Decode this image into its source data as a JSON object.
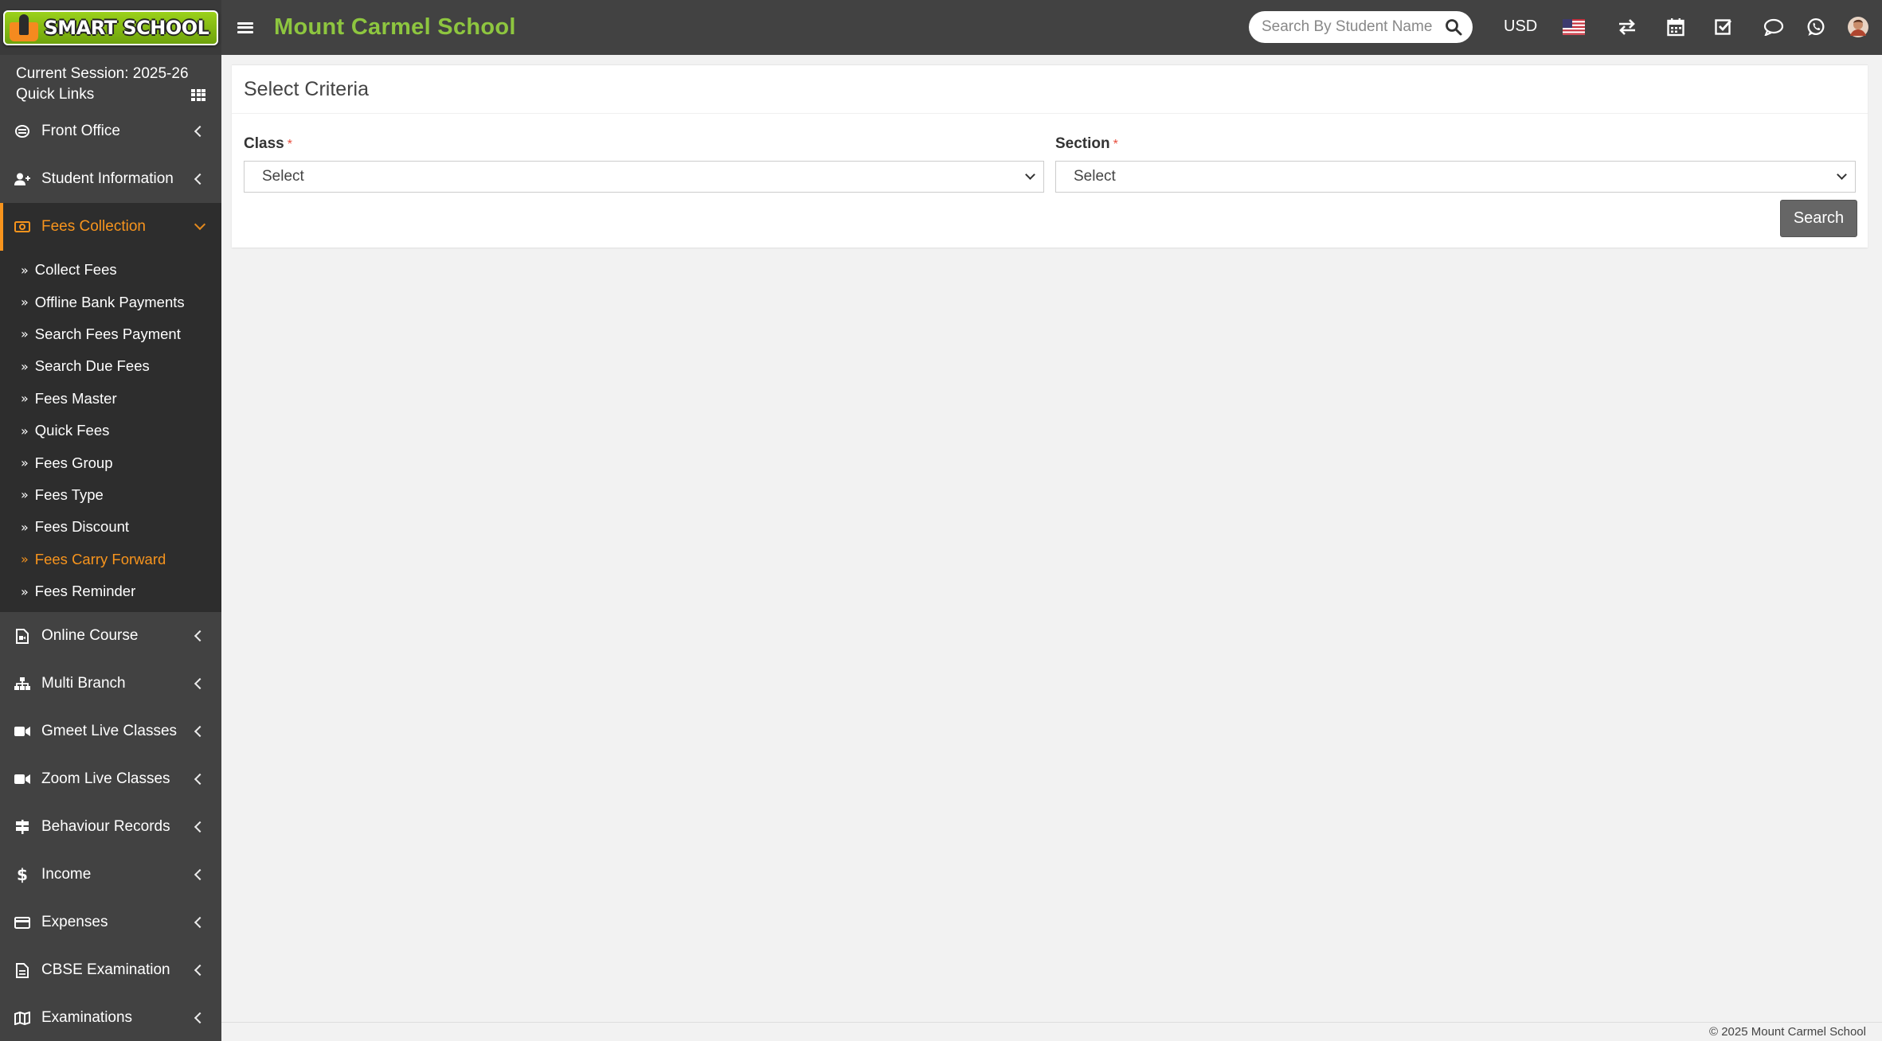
{
  "header": {
    "logo_text": "SMART SCHOOL",
    "school_name": "Mount Carmel School",
    "search_placeholder": "Search By Student Name",
    "currency": "USD",
    "icons": [
      "flag-us-icon",
      "swap-icon",
      "calendar-icon",
      "task-check-icon",
      "chat-icon",
      "whatsapp-icon",
      "user-avatar"
    ],
    "accent_color": "#8ec63f"
  },
  "sidebar": {
    "session": "Current Session: 2025-26",
    "quick_links": "Quick Links",
    "items": [
      {
        "label": "Front Office",
        "icon": "front-office-icon"
      },
      {
        "label": "Student Information",
        "icon": "user-plus-icon"
      },
      {
        "label": "Fees Collection",
        "icon": "money-icon",
        "active": true
      },
      {
        "label": "Online Course",
        "icon": "file-video-icon"
      },
      {
        "label": "Multi Branch",
        "icon": "sitemap-icon"
      },
      {
        "label": "Gmeet Live Classes",
        "icon": "video-icon"
      },
      {
        "label": "Zoom Live Classes",
        "icon": "video-icon"
      },
      {
        "label": "Behaviour Records",
        "icon": "signpost-icon"
      },
      {
        "label": "Income",
        "icon": "dollar-icon"
      },
      {
        "label": "Expenses",
        "icon": "credit-card-icon"
      },
      {
        "label": "CBSE Examination",
        "icon": "document-icon"
      },
      {
        "label": "Examinations",
        "icon": "map-icon"
      }
    ],
    "fees_submenu": [
      {
        "label": "Collect Fees"
      },
      {
        "label": "Offline Bank Payments"
      },
      {
        "label": "Search Fees Payment"
      },
      {
        "label": "Search Due Fees"
      },
      {
        "label": "Fees Master"
      },
      {
        "label": "Quick Fees"
      },
      {
        "label": "Fees Group"
      },
      {
        "label": "Fees Type"
      },
      {
        "label": "Fees Discount"
      },
      {
        "label": "Fees Carry Forward",
        "current": true
      },
      {
        "label": "Fees Reminder"
      }
    ],
    "active_color": "#f7941d"
  },
  "main": {
    "title": "Select Criteria",
    "class_label": "Class",
    "section_label": "Section",
    "required_mark": "*",
    "class_value": "Select",
    "section_value": "Select",
    "search_button": "Search"
  },
  "footer": {
    "copyright": "© 2025 Mount Carmel School"
  }
}
